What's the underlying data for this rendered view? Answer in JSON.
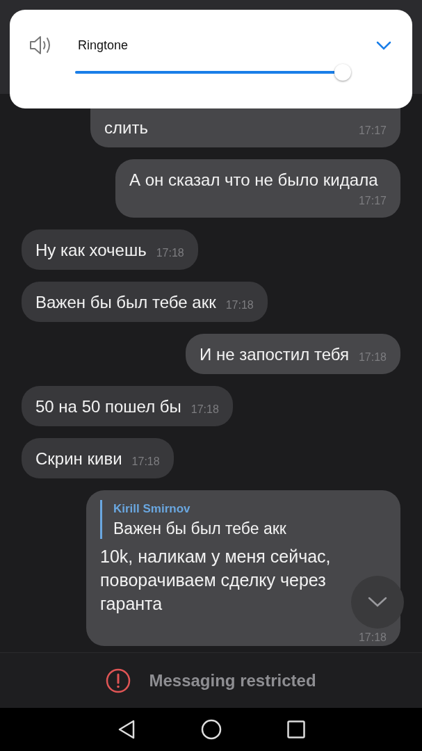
{
  "volume_panel": {
    "label": "Ringtone",
    "level": 0.97
  },
  "messages": [
    {
      "kind": "outgoing",
      "text": "слить",
      "time": "17:17"
    },
    {
      "kind": "outgoing",
      "text": "А он сказал что не было кидала",
      "time": "17:17"
    },
    {
      "kind": "incoming",
      "text": "Ну как хочешь",
      "time": "17:18"
    },
    {
      "kind": "incoming",
      "text": "Важен бы был тебе акк",
      "time": "17:18"
    },
    {
      "kind": "outgoing",
      "text": "И не запостил тебя",
      "time": "17:18"
    },
    {
      "kind": "incoming",
      "text": "50 на 50 пошел бы",
      "time": "17:18"
    },
    {
      "kind": "incoming",
      "text": "Скрин киви",
      "time": "17:18"
    },
    {
      "kind": "outgoing",
      "reply": {
        "name": "Kirill Smirnov",
        "text": "Важен бы был тебе акк"
      },
      "text": "10k, наликам у меня сейчас, поворачиваем сделку через гаранта",
      "time": "17:18"
    }
  ],
  "bottom_bar": {
    "text": "Messaging restricted"
  }
}
